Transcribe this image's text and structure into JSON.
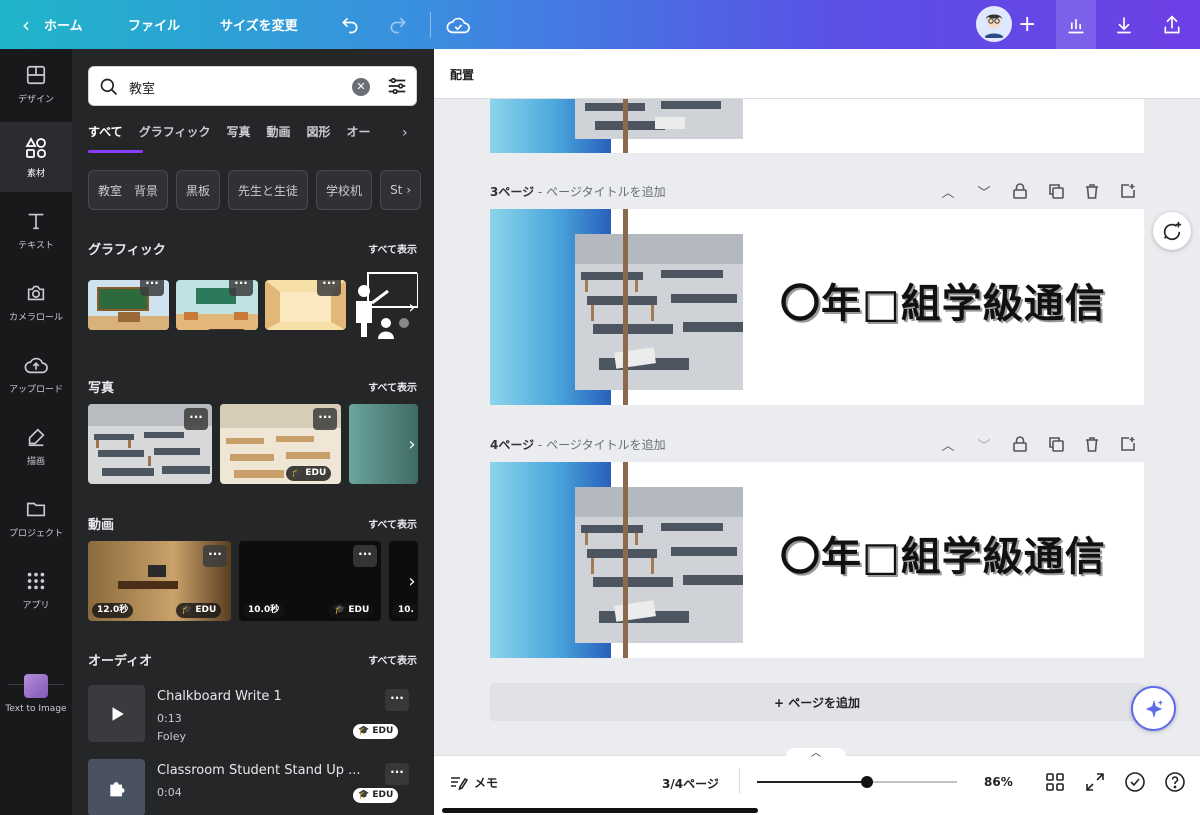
{
  "topbar": {
    "home": "ホーム",
    "file": "ファイル",
    "resize": "サイズを変更",
    "plus": "+"
  },
  "rail": {
    "items": [
      {
        "label": "デザイン",
        "icon": "layout-icon"
      },
      {
        "label": "素材",
        "icon": "elements-icon"
      },
      {
        "label": "テキスト",
        "icon": "text-icon"
      },
      {
        "label": "カメラロール",
        "icon": "camera-icon"
      },
      {
        "label": "アップロード",
        "icon": "upload-icon"
      },
      {
        "label": "描画",
        "icon": "draw-icon"
      },
      {
        "label": "プロジェクト",
        "icon": "folder-icon"
      },
      {
        "label": "アプリ",
        "icon": "apps-icon"
      },
      {
        "label": "Text to Image",
        "icon": "text-to-image-icon"
      }
    ]
  },
  "panel": {
    "search_value": "教室",
    "tabs": [
      "すべて",
      "グラフィック",
      "写真",
      "動画",
      "図形",
      "オー"
    ],
    "chips": [
      "教室　背景",
      "黒板",
      "先生と生徒",
      "学校机",
      "St"
    ],
    "sections": {
      "graphics": {
        "title": "グラフィック",
        "more": "すべて表示"
      },
      "photos": {
        "title": "写真",
        "more": "すべて表示"
      },
      "videos": {
        "title": "動画",
        "more": "すべて表示"
      },
      "audio": {
        "title": "オーディオ",
        "more": "すべて表示"
      }
    },
    "badge_edu": "EDU",
    "dots": "···",
    "videos": [
      {
        "duration": "12.0秒"
      },
      {
        "duration": "10.0秒"
      },
      {
        "duration": "10."
      }
    ],
    "audio_items": [
      {
        "title": "Chalkboard Write 1",
        "duration": "0:13",
        "genre": "Foley"
      },
      {
        "title": "Classroom Student Stand Up ...",
        "duration": "0:04",
        "genre": ""
      }
    ]
  },
  "main": {
    "header": "配置",
    "pages": [
      {
        "label": "3ページ",
        "subtitle": "ページタイトルを追加",
        "title": "〇年□組学級通信"
      },
      {
        "label": "4ページ",
        "subtitle": "ページタイトルを追加",
        "title": "〇年□組学級通信"
      }
    ],
    "add_page": "+ ページを追加",
    "memo": "メモ",
    "page_counter": "3/4ページ",
    "zoom": "86%",
    "zoom_fraction": 0.55
  },
  "colors": {
    "accent": "#8b3dff",
    "panel_bg": "#252627",
    "rail_bg": "#18191b"
  }
}
